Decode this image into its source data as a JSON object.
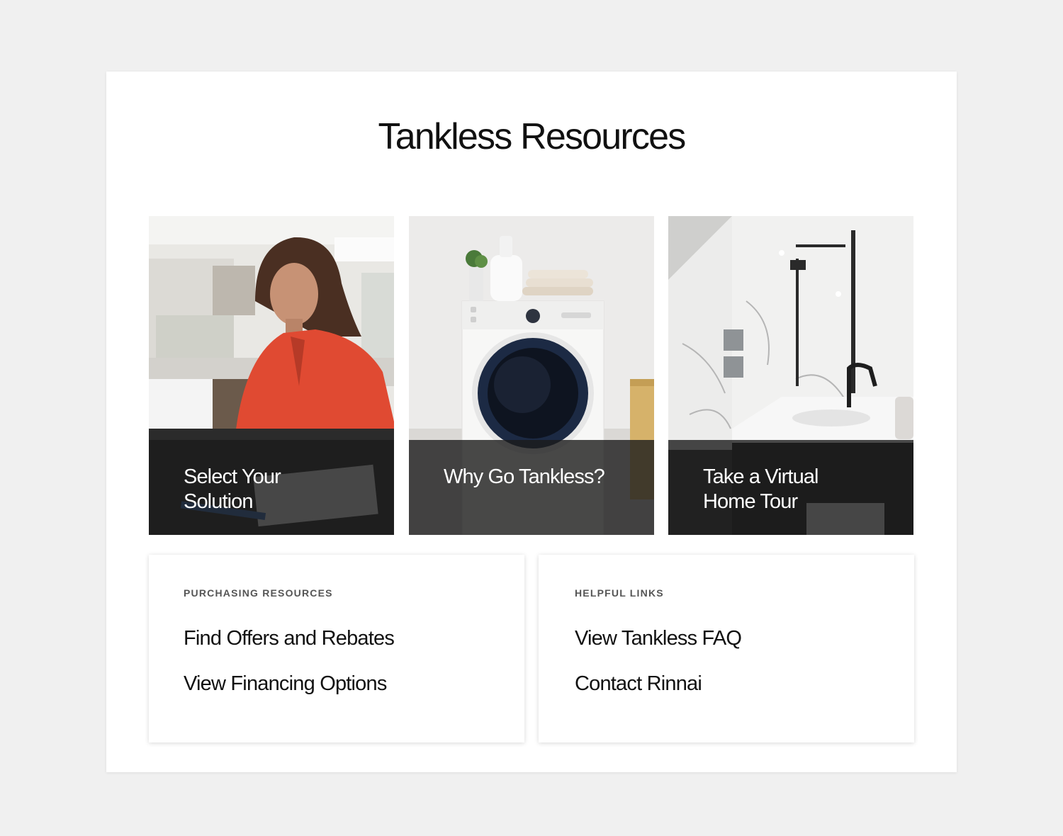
{
  "title": "Tankless Resources",
  "tiles": [
    {
      "label": "Select Your Solution",
      "image": "woman-working-on-laptop-photo"
    },
    {
      "label": "Why Go Tankless?",
      "image": "washing-machine-photo"
    },
    {
      "label": "Take a Virtual Home Tour",
      "image": "modern-bathroom-shower-photo"
    }
  ],
  "cards": [
    {
      "heading": "PURCHASING RESOURCES",
      "links": [
        "Find Offers and Rebates",
        "View Financing Options"
      ]
    },
    {
      "heading": "HELPFUL LINKS",
      "links": [
        "View Tankless FAQ",
        "Contact Rinnai"
      ]
    }
  ],
  "colors": {
    "page_background": "#f0f0f0",
    "panel_background": "#ffffff",
    "overlay": "#1c1c1c",
    "text": "#111111",
    "heading_muted": "#555555"
  }
}
